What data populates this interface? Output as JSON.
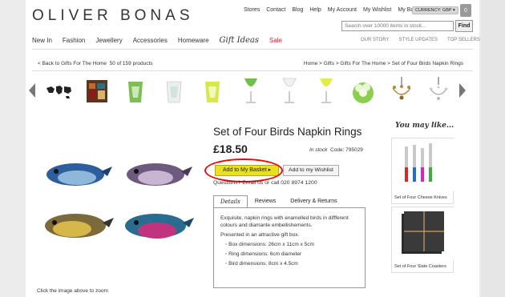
{
  "brand": {
    "logo": "OLIVER BONAS"
  },
  "top_links": [
    "Stores",
    "Contact",
    "Blog",
    "Help",
    "My Account",
    "My Wishlist",
    "My Basket"
  ],
  "currency": {
    "label": "CURRENCY: GBP"
  },
  "basket": {
    "count": "0"
  },
  "search": {
    "placeholder": "Search over 10000 items in stock...",
    "button": "Find"
  },
  "nav": {
    "items": [
      "New In",
      "Fashion",
      "Jewellery",
      "Accessories",
      "Homeware"
    ],
    "gift_ideas": "Gift Ideas",
    "sale": "Sale",
    "secondary": [
      "OUR STORY",
      "STYLE UPDATES",
      "TOP SELLERS"
    ]
  },
  "breadcrumb": {
    "back": "< Back to Gifts For The Home",
    "count": "50 of 159 products",
    "trail": "Home > Gifts > Gifts For The Home > Set of Four Birds Napkin Rings"
  },
  "product": {
    "title": "Set of Four Birds Napkin Rings",
    "price": "£18.50",
    "stock": "In stock",
    "code": "Code: 795029",
    "add_to_basket": "Add to My Basket ▸",
    "add_to_wishlist": "Add to my Wishlist",
    "questions": "Questions? Email us or call 020 8974 1200",
    "click_hint": "Click the image above to zoom"
  },
  "tabs": [
    "Details",
    "Reviews",
    "Delivery & Returns"
  ],
  "details": {
    "intro": "Exquisite, napkin rings with enamelled birds in diffferent colours and diamante embellishements.",
    "presented": "Presented in an attractive gift box.",
    "bullets": [
      "Box dimensions: 26cm x 11cm x 5cm",
      "Ring dimensions: 6cm diameter",
      "Bird dimensions: 8cm x 4.5cm"
    ]
  },
  "you_may_like": {
    "heading": "You may like...",
    "items": [
      "Set of Four Cheese Knives",
      "Set of Four Slate Coasters"
    ]
  },
  "colors": {
    "sale": "#d6232a",
    "add_button": "#e8e020",
    "highlight_ring": "#e10d0d"
  }
}
